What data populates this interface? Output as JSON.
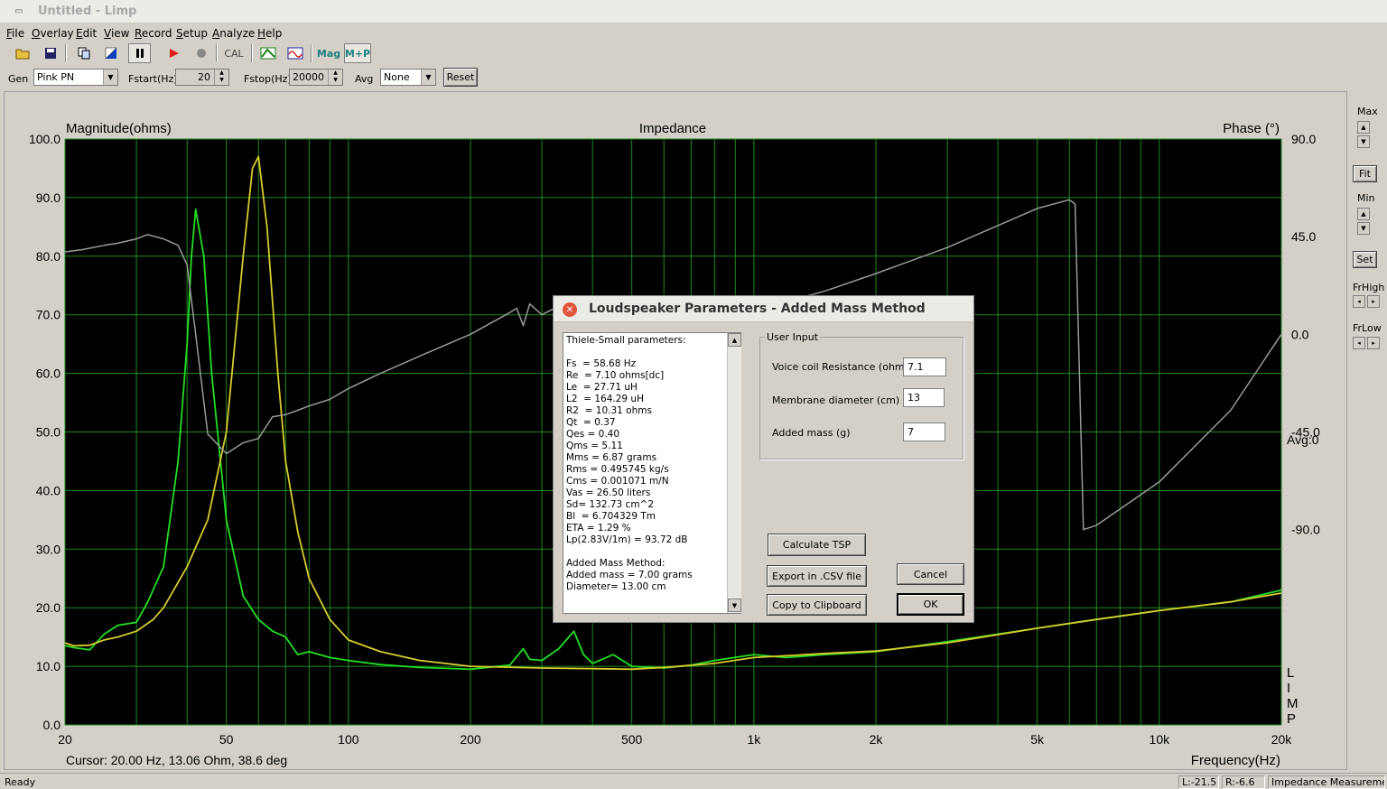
{
  "window": {
    "title": "Untitled - Limp",
    "sys_icon": "window-menu-icon"
  },
  "menu": [
    "File",
    "Overlay",
    "Edit",
    "View",
    "Record",
    "Setup",
    "Analyze",
    "Help"
  ],
  "toolbar": {
    "icons": [
      "open-folder-icon",
      "save-icon",
      "copy-icon",
      "color-icon",
      "pause-icon",
      "record-icon",
      "stop-icon",
      "cal-icon",
      "impedance-icon",
      "wave-icon"
    ],
    "cal_label": "CAL",
    "mag_label": "Mag",
    "mp_label": "M+P"
  },
  "genbar": {
    "gen_label": "Gen",
    "gen_value": "Pink PN",
    "fstart_label": "Fstart(Hz)",
    "fstart_value": "20",
    "fstop_label": "Fstop(Hz)",
    "fstop_value": "20000",
    "avg_label": "Avg",
    "avg_value": "None",
    "reset_label": "Reset"
  },
  "right_panel": {
    "max_label": "Max",
    "fit_label": "Fit",
    "min_label": "Min",
    "set_label": "Set",
    "frhigh_label": "FrHigh",
    "frlow_label": "FrLow"
  },
  "chart": {
    "title": "Impedance",
    "left_axis_label": "Magnitude(ohms)",
    "right_axis_label": "Phase (°)",
    "x_axis_label": "Frequency(Hz)",
    "y_ticks": [
      "100.0",
      "90.0",
      "80.0",
      "70.0",
      "60.0",
      "50.0",
      "40.0",
      "30.0",
      "20.0",
      "10.0",
      "0.0"
    ],
    "phase_ticks": [
      "90.0",
      "45.0",
      "0.0",
      "-45.0",
      "-90.0"
    ],
    "x_ticks": [
      "20",
      "50",
      "100",
      "200",
      "500",
      "1k",
      "2k",
      "5k",
      "10k",
      "20k"
    ],
    "avg_text": "Avg:0",
    "side_label": "LIMP",
    "cursor_text": "Cursor: 20.00 Hz, 13.06 Ohm, 38.6 deg"
  },
  "chart_data": {
    "type": "line",
    "xscale": "log",
    "xlim": [
      20,
      20000
    ],
    "ylim": [
      0,
      100
    ],
    "y2lim": [
      -180,
      90
    ],
    "colors": {
      "free_air": "#22e022",
      "added_mass": "#d8cc2c",
      "phase": "#9a9a9a",
      "grid": "#1c8c1c",
      "background": "#000000"
    },
    "series": [
      {
        "x": [
          20,
          21,
          23,
          25,
          27,
          30,
          32,
          35,
          38,
          40,
          41,
          42,
          44,
          46,
          50,
          55,
          60,
          65,
          70,
          75,
          80,
          90,
          100,
          120,
          150,
          200,
          250,
          270,
          280,
          300,
          330,
          360,
          380,
          400,
          450,
          500,
          600,
          700,
          800,
          1000,
          1200,
          1500,
          2000,
          3000,
          5000,
          7000,
          10000,
          15000,
          20000
        ],
        "y": [
          13.5,
          13.2,
          12.8,
          15.5,
          17,
          17.5,
          21,
          27,
          45,
          65,
          80,
          88,
          80,
          60,
          35,
          22,
          18,
          16,
          15,
          12,
          12.5,
          11.5,
          11,
          10.3,
          9.8,
          9.5,
          10.2,
          13,
          11.2,
          11,
          13,
          16,
          12,
          10.5,
          12,
          10,
          9.7,
          10.2,
          11,
          12,
          11.5,
          12,
          12.5,
          14.2,
          16.5,
          18,
          19.5,
          21,
          23
        ]
      },
      {
        "x": [
          20,
          21,
          23,
          25,
          27,
          30,
          33,
          35,
          40,
          45,
          50,
          55,
          58,
          60,
          63,
          67,
          70,
          75,
          80,
          90,
          100,
          120,
          150,
          200,
          300,
          400,
          500,
          600,
          800,
          1000,
          1200,
          1500,
          2000,
          3000,
          5000,
          7000,
          10000,
          15000,
          20000
        ],
        "y": [
          14,
          13.5,
          13.6,
          14.5,
          15,
          16,
          18,
          20,
          27,
          35,
          50,
          80,
          95,
          97,
          85,
          60,
          45,
          33,
          25,
          18,
          14.5,
          12.5,
          11,
          10,
          9.7,
          9.6,
          9.5,
          9.8,
          10.5,
          11.5,
          11.8,
          12.2,
          12.6,
          14,
          16.5,
          18,
          19.5,
          21,
          22.5
        ]
      },
      {
        "x": [
          20,
          22,
          25,
          27,
          30,
          32,
          35,
          38,
          40,
          42,
          45,
          50,
          55,
          60,
          65,
          70,
          75,
          80,
          90,
          100,
          120,
          150,
          200,
          250,
          260,
          270,
          280,
          300,
          330,
          350,
          360,
          380,
          400,
          450,
          500,
          600,
          800,
          1000,
          1200,
          1500,
          2000,
          3000,
          5000,
          6000,
          6200,
          6500,
          7000,
          10000,
          15000,
          20000
        ],
        "y": [
          38,
          39,
          41,
          42,
          44,
          46,
          44,
          41,
          32,
          0,
          -46,
          -55,
          -50,
          -48,
          -38,
          -37,
          -35,
          -33,
          -30,
          -25,
          -18,
          -10,
          0,
          10,
          12,
          4,
          14,
          9,
          13,
          12,
          -5,
          -8,
          -9,
          1,
          -1,
          6,
          13,
          17,
          15,
          20,
          28,
          40,
          58,
          62,
          60,
          -90,
          -88,
          -68,
          -35,
          0
        ]
      }
    ]
  },
  "dialog": {
    "title": "Loudspeaker Parameters - Added Mass Method",
    "close_icon": "close-icon",
    "ts_lines": [
      "Thiele-Small parameters:",
      "",
      "Fs  = 58.68 Hz",
      "Re  = 7.10 ohms[dc]",
      "Le  = 27.71 uH",
      "L2  = 164.29 uH",
      "R2  = 10.31 ohms",
      "Qt  = 0.37",
      "Qes = 0.40",
      "Qms = 5.11",
      "Mms = 6.87 grams",
      "Rms = 0.495745 kg/s",
      "Cms = 0.001071 m/N",
      "Vas = 26.50 liters",
      "Sd= 132.73 cm^2",
      "Bl  = 6.704329 Tm",
      "ETA = 1.29 %",
      "Lp(2.83V/1m) = 93.72 dB",
      "",
      "Added Mass Method:",
      "Added mass = 7.00 grams",
      "Diameter= 13.00 cm"
    ],
    "user_input_label": "User Input",
    "vc_label": "Voice coil Resistance (ohms)",
    "vc_value": "7.1",
    "md_label": "Membrane diameter (cm)",
    "md_value": "13",
    "am_label": "Added mass (g)",
    "am_value": "7",
    "calc_label": "Calculate TSP",
    "export_label": "Export in .CSV file",
    "copy_label": "Copy to Clipboard",
    "cancel_label": "Cancel",
    "ok_label": "OK"
  },
  "status": {
    "ready": "Ready",
    "l": "L:-21.5",
    "r": "R:-6.6",
    "mode": "Impedance Measurement"
  }
}
